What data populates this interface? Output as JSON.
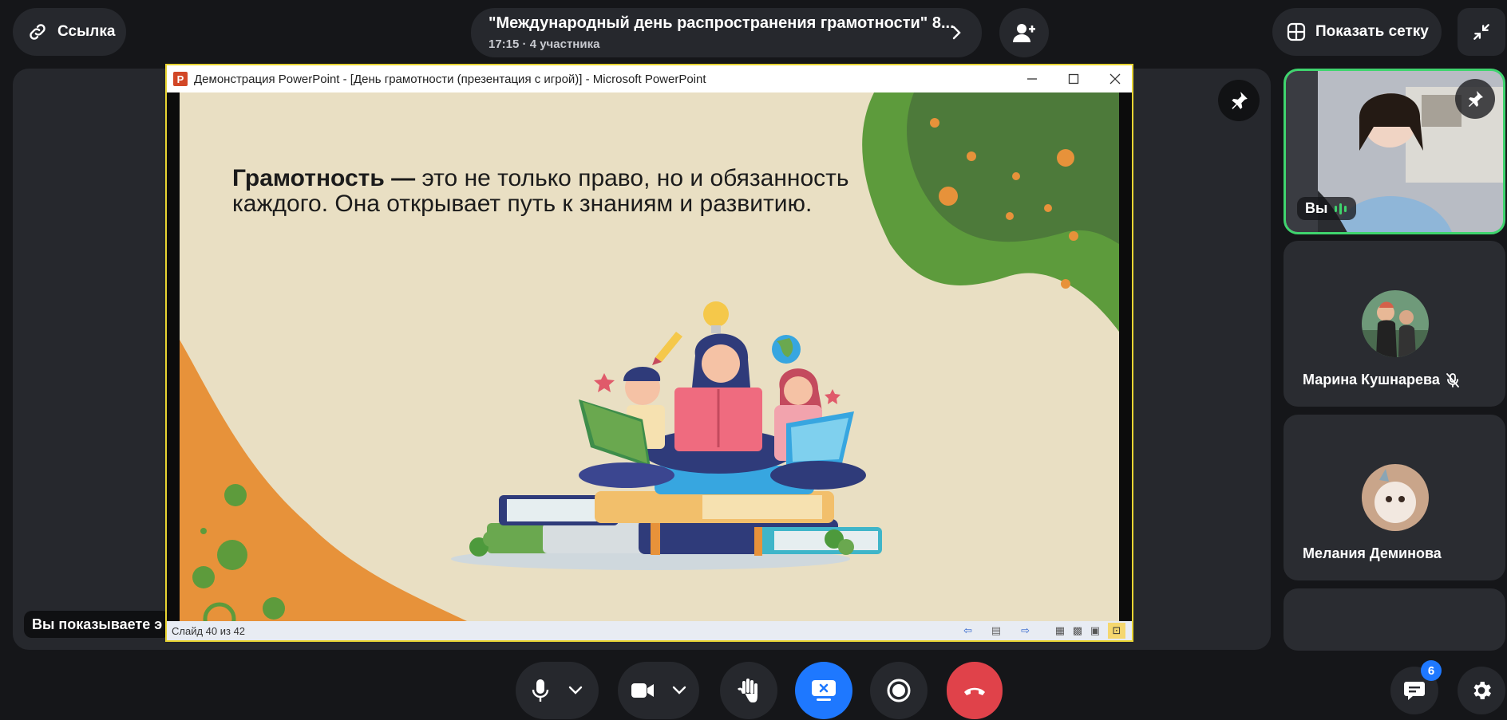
{
  "header": {
    "link_label": "Ссылка",
    "meeting_title": "\"Международный день распространения грамотности\" 8...",
    "meeting_meta": "17:15 · 4 участника",
    "grid_label": "Показать сетку"
  },
  "stage": {
    "share_label": "Вы показываете э"
  },
  "powerpoint": {
    "window_title": "Демонстрация PowerPoint - [День грамотности (презентация с игрой)] - Microsoft PowerPoint",
    "app_icon_letter": "P",
    "slide_bold": "Грамотность —",
    "slide_text": " это не только право, но и обязанность каждого. Она открывает путь к знаниям и развитию.",
    "status_text": "Слайд 40 из 42"
  },
  "participants": [
    {
      "name": "Вы",
      "is_self": true
    },
    {
      "name": "Марина Кушнарева",
      "muted": true
    },
    {
      "name": "Мелания Деминова",
      "muted": false
    }
  ],
  "controls": {
    "chat_badge": "6"
  },
  "colors": {
    "background": "#151619",
    "surface": "#26282d",
    "share_blue": "#1e78ff",
    "hangup_red": "#e0424a",
    "speaking_green": "#3fd46e",
    "slide_bg": "#e9dfc3",
    "slide_green": "#5d9b3c",
    "slide_orange": "#e7923a"
  }
}
